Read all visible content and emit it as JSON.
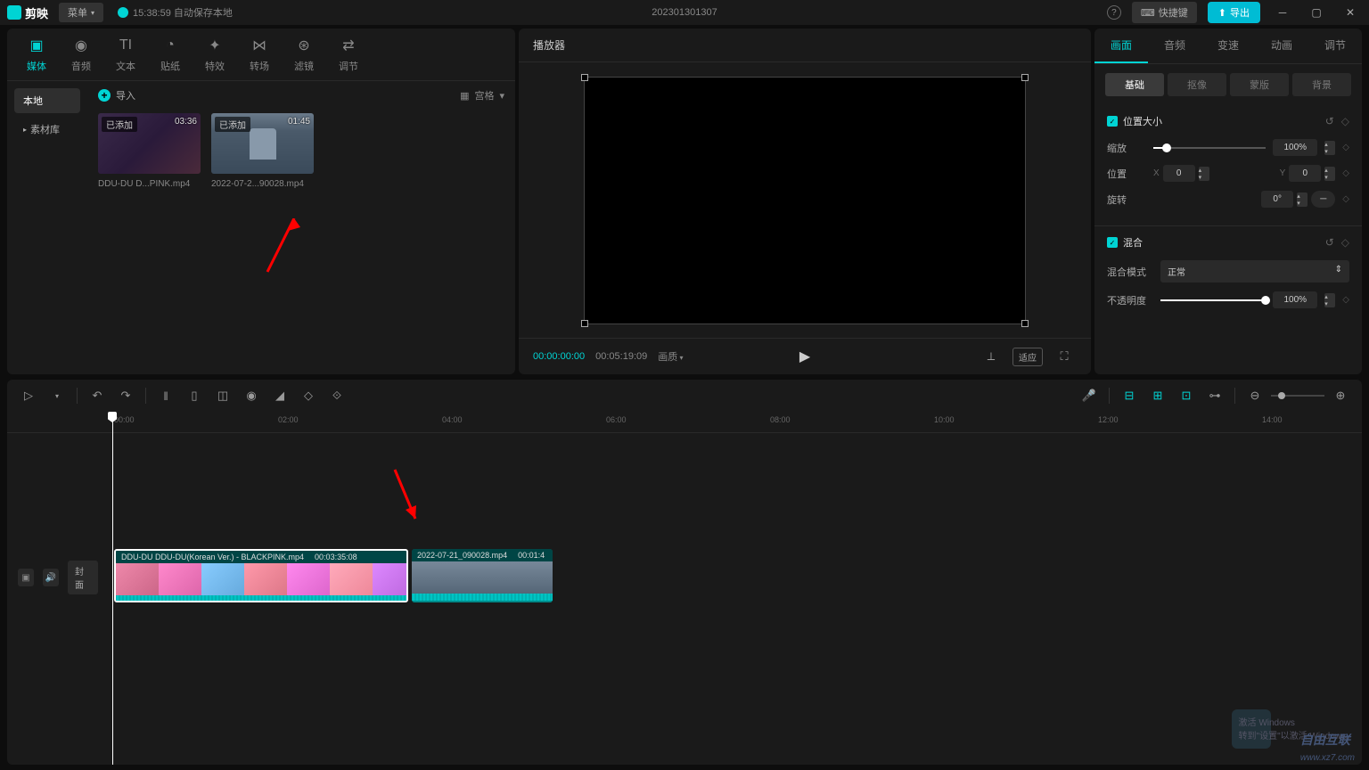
{
  "titlebar": {
    "app_name": "剪映",
    "menu_label": "菜单",
    "autosave": "15:38:59 自动保存本地",
    "project_name": "202301301307",
    "shortcut_label": "快捷键",
    "export_label": "导出"
  },
  "left_tabs": [
    {
      "icon": "▣",
      "label": "媒体"
    },
    {
      "icon": "◉",
      "label": "音频"
    },
    {
      "icon": "TI",
      "label": "文本"
    },
    {
      "icon": "◔",
      "label": "贴纸"
    },
    {
      "icon": "✦",
      "label": "特效"
    },
    {
      "icon": "⋈",
      "label": "转场"
    },
    {
      "icon": "⊛",
      "label": "滤镜"
    },
    {
      "icon": "⇄",
      "label": "调节"
    }
  ],
  "left_sidebar": {
    "local": "本地",
    "library": "素材库"
  },
  "import_label": "导入",
  "view_label": "宫格",
  "media_items": [
    {
      "badge": "已添加",
      "duration": "03:36",
      "name": "DDU-DU D...PINK.mp4"
    },
    {
      "badge": "已添加",
      "duration": "01:45",
      "name": "2022-07-2...90028.mp4"
    }
  ],
  "preview": {
    "title": "播放器",
    "current_time": "00:00:00:00",
    "total_time": "00:05:19:09",
    "quality": "画质",
    "ratio_btn": "适应"
  },
  "right_tabs": [
    "画面",
    "音频",
    "变速",
    "动画",
    "调节"
  ],
  "right_subtabs": [
    "基础",
    "抠像",
    "蒙版",
    "背景"
  ],
  "props": {
    "position_size": "位置大小",
    "scale": "缩放",
    "scale_val": "100%",
    "position": "位置",
    "pos_x_label": "X",
    "pos_x": "0",
    "pos_y_label": "Y",
    "pos_y": "0",
    "rotation": "旋转",
    "rotation_val": "0°",
    "blend": "混合",
    "blend_mode_label": "混合模式",
    "blend_mode": "正常",
    "opacity": "不透明度",
    "opacity_val": "100%"
  },
  "ruler_marks": [
    "00:00",
    "02:00",
    "04:00",
    "06:00",
    "08:00",
    "10:00",
    "12:00",
    "14:00"
  ],
  "track": {
    "cover": "封面"
  },
  "clips": [
    {
      "name": "DDU-DU DDU-DU(Korean Ver.) - BLACKPINK.mp4",
      "duration": "00:03:35:08"
    },
    {
      "name": "2022-07-21_090028.mp4",
      "duration": "00:01:4"
    }
  ],
  "watermark": {
    "line1": "激活 Windows",
    "line2": "转到\"设置\"以激活 Windows。",
    "brand": "自由互联",
    "url": "www.xz7.com"
  }
}
